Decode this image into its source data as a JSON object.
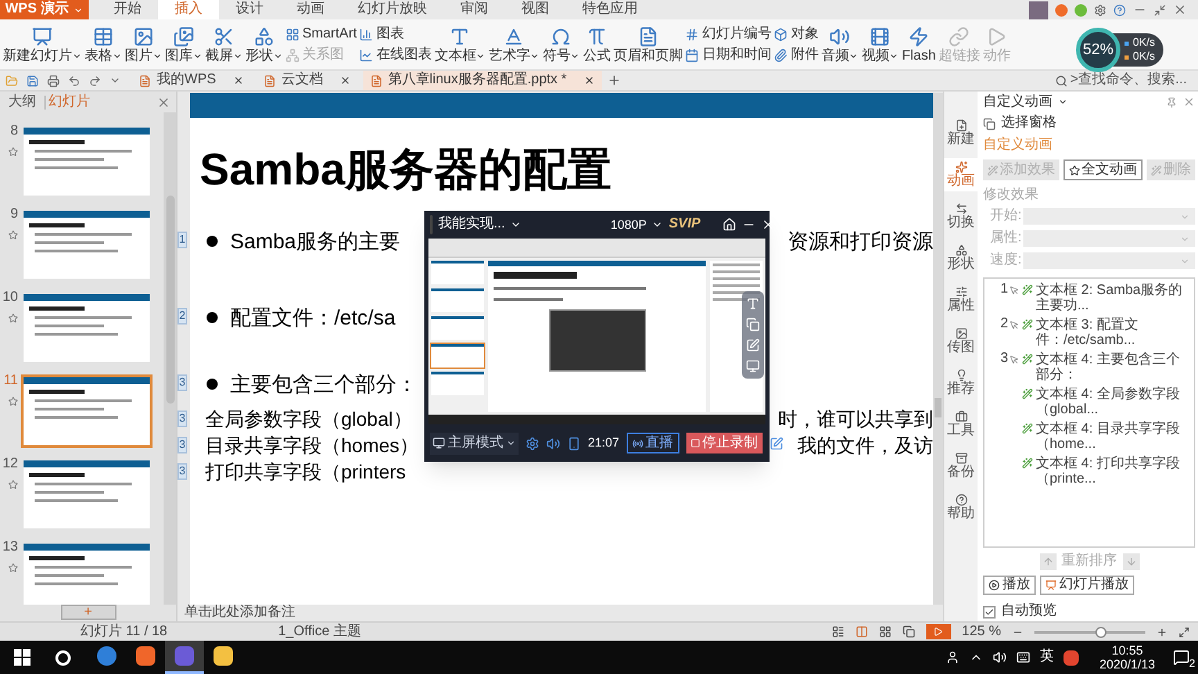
{
  "app_menu": {
    "label": "WPS 演示"
  },
  "menu_tabs": [
    {
      "label": "开始",
      "selected": false
    },
    {
      "label": "插入",
      "selected": true
    },
    {
      "label": "设计",
      "selected": false
    },
    {
      "label": "动画",
      "selected": false
    },
    {
      "label": "幻灯片放映",
      "selected": false
    },
    {
      "label": "审阅",
      "selected": false
    },
    {
      "label": "视图",
      "selected": false
    },
    {
      "label": "特色应用",
      "selected": false
    }
  ],
  "ribbon": [
    {
      "kind": "large",
      "label": "新建幻灯片",
      "dropdown": true,
      "disabled": false
    },
    {
      "kind": "large",
      "label": "表格",
      "dropdown": true,
      "disabled": false
    },
    {
      "kind": "large",
      "label": "图片",
      "dropdown": true,
      "disabled": false
    },
    {
      "kind": "large",
      "label": "图库",
      "dropdown": true,
      "disabled": false
    },
    {
      "kind": "large",
      "label": "截屏",
      "dropdown": true,
      "disabled": false
    },
    {
      "kind": "large",
      "label": "形状",
      "dropdown": true,
      "disabled": false
    },
    {
      "kind": "stack",
      "items": [
        {
          "label": "SmartArt",
          "disabled": false
        },
        {
          "label": "关系图",
          "disabled": true
        }
      ]
    },
    {
      "kind": "stack",
      "items": [
        {
          "label": "图表",
          "disabled": false
        },
        {
          "label": "在线图表",
          "disabled": false
        }
      ]
    },
    {
      "kind": "large",
      "label": "文本框",
      "dropdown": true,
      "disabled": false
    },
    {
      "kind": "large",
      "label": "艺术字",
      "dropdown": true,
      "disabled": false
    },
    {
      "kind": "large",
      "label": "符号",
      "dropdown": true,
      "disabled": false
    },
    {
      "kind": "large",
      "label": "公式",
      "dropdown": false,
      "disabled": false
    },
    {
      "kind": "large",
      "label": "页眉和页脚",
      "dropdown": false,
      "disabled": false
    },
    {
      "kind": "stack",
      "items": [
        {
          "label": "幻灯片编号",
          "disabled": false
        },
        {
          "label": "日期和时间",
          "disabled": false
        }
      ]
    },
    {
      "kind": "stack",
      "items": [
        {
          "label": "对象",
          "disabled": false
        },
        {
          "label": "附件",
          "disabled": false
        }
      ]
    },
    {
      "kind": "large",
      "label": "音频",
      "dropdown": true,
      "disabled": false
    },
    {
      "kind": "large",
      "label": "视频",
      "dropdown": true,
      "disabled": false
    },
    {
      "kind": "large",
      "label": "Flash",
      "dropdown": false,
      "disabled": false
    },
    {
      "kind": "large",
      "label": "超链接",
      "dropdown": false,
      "disabled": true
    },
    {
      "kind": "large",
      "label": "动作",
      "dropdown": false,
      "disabled": true
    }
  ],
  "doc_tabs": [
    {
      "label": "我的WPS",
      "selected": false
    },
    {
      "label": "云文档",
      "selected": false
    },
    {
      "label": "第八章linux服务器配置.pptx *",
      "selected": true
    }
  ],
  "search": {
    "placeholder": ">查找命令、搜索..."
  },
  "net_monitor": {
    "percent": "52%",
    "upload": "0K/s",
    "download": "0K/s"
  },
  "slides_panel": {
    "tabs": [
      {
        "label": "大纲",
        "selected": false
      },
      {
        "label": "幻灯片",
        "selected": true
      }
    ],
    "thumbnails": [
      {
        "number": "8",
        "selected": false
      },
      {
        "number": "9",
        "selected": false
      },
      {
        "number": "10",
        "selected": false
      },
      {
        "number": "11",
        "selected": true
      },
      {
        "number": "12",
        "selected": false
      },
      {
        "number": "13",
        "selected": false
      }
    ],
    "add_button": "+"
  },
  "slide": {
    "title": "Samba服务器的配置",
    "items": [
      {
        "kind": "bullet",
        "tag": "1",
        "text": "Samba服务的主要",
        "trailing": "资源和打印资源"
      },
      {
        "kind": "bullet",
        "tag": "2",
        "text": "配置文件：/etc/sa"
      },
      {
        "kind": "bullet",
        "tag": "3",
        "text": "主要包含三个部分："
      },
      {
        "kind": "line",
        "tag": "3",
        "text": "全局参数字段（global）",
        "trailing": "时，谁可以共享到"
      },
      {
        "kind": "line",
        "tag": "3",
        "text": "目录共享字段（homes）",
        "trailing": "我的文件，及访"
      },
      {
        "kind": "line",
        "tag": "3",
        "text": "打印共享字段（printers"
      }
    ]
  },
  "recorder": {
    "title": "我能实现...",
    "quality": "1080P",
    "badge": "SVIP",
    "mode": "主屏模式",
    "time": "21:07",
    "live_button": "直播",
    "stop_button": "停止录制"
  },
  "notes": {
    "placeholder": "单击此处添加备注"
  },
  "side_tabs": [
    {
      "label": "新建",
      "selected": false
    },
    {
      "label": "动画",
      "selected": true
    },
    {
      "label": "切换",
      "selected": false
    },
    {
      "label": "形状",
      "selected": false
    },
    {
      "label": "属性",
      "selected": false
    },
    {
      "label": "传图",
      "selected": false
    },
    {
      "label": "推荐",
      "selected": false
    },
    {
      "label": "工具",
      "selected": false
    },
    {
      "label": "备份",
      "selected": false
    },
    {
      "label": "帮助",
      "selected": false
    }
  ],
  "animation_pane": {
    "title": "自定义动画",
    "selection_pane": "选择窗格",
    "section": "自定义动画",
    "buttons": [
      {
        "label": "添加效果",
        "disabled": true
      },
      {
        "label": "全文动画",
        "disabled": false
      },
      {
        "label": "删除",
        "disabled": true
      }
    ],
    "modify_heading": "修改效果",
    "fields": [
      {
        "label": "开始:"
      },
      {
        "label": "属性:"
      },
      {
        "label": "速度:"
      }
    ],
    "effects": [
      {
        "number": "1",
        "text": "文本框 2: Samba服务的主要功..."
      },
      {
        "number": "2",
        "text": "文本框 3: 配置文件：/etc/samb..."
      },
      {
        "number": "3",
        "text": "文本框 4: 主要包含三个部分："
      },
      {
        "text": "文本框 4: 全局参数字段（global..."
      },
      {
        "text": "文本框 4: 目录共享字段（home..."
      },
      {
        "text": "文本框 4: 打印共享字段（printe..."
      }
    ],
    "reorder": {
      "label": "重新排序",
      "disabled": true
    },
    "play_button": "播放",
    "slideshow_button": "幻灯片播放",
    "auto_preview": {
      "label": "自动预览",
      "checked": true
    }
  },
  "status_bar": {
    "slide": "幻灯片 11 / 18",
    "theme": "1_Office 主题",
    "zoom": "125 %",
    "zoom_slider": {
      "level": 0.6
    }
  },
  "taskbar": {
    "apps": [
      {
        "selected": false
      },
      {
        "selected": false
      },
      {
        "selected": true
      },
      {
        "selected": false
      }
    ],
    "ime": "英",
    "time": "10:55",
    "date": "2020/1/13",
    "notifications": "2"
  }
}
